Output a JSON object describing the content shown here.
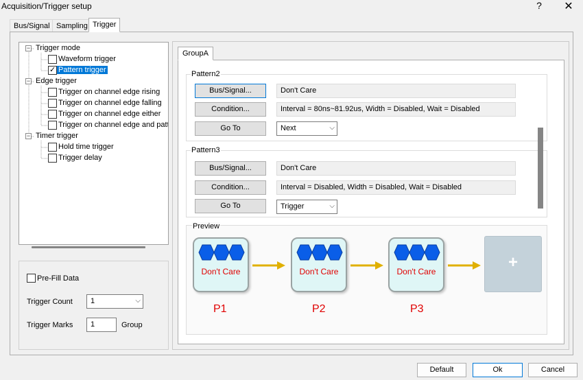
{
  "window": {
    "title": "Acquisition/Trigger setup",
    "help_glyph": "?",
    "close_glyph": "✕"
  },
  "tabs": [
    {
      "label": "Bus/Signal"
    },
    {
      "label": "Sampling"
    },
    {
      "label": "Trigger",
      "active": true
    }
  ],
  "tree": {
    "groups": [
      {
        "label": "Trigger mode",
        "items": [
          {
            "label": "Waveform trigger",
            "checked": false
          },
          {
            "label": "Pattern trigger",
            "checked": true,
            "selected": true
          }
        ]
      },
      {
        "label": "Edge trigger",
        "items": [
          {
            "label": "Trigger on channel edge rising",
            "checked": false
          },
          {
            "label": "Trigger on channel edge falling",
            "checked": false
          },
          {
            "label": "Trigger on channel edge either",
            "checked": false
          },
          {
            "label": "Trigger on channel edge and patt",
            "checked": false
          }
        ]
      },
      {
        "label": "Timer trigger",
        "items": [
          {
            "label": "Hold time trigger",
            "checked": false
          },
          {
            "label": "Trigger delay",
            "checked": false
          }
        ]
      }
    ]
  },
  "options": {
    "prefill_label": "Pre-Fill Data",
    "prefill_checked": false,
    "trigger_count_label": "Trigger Count",
    "trigger_count_value": "1",
    "trigger_marks_label": "Trigger Marks",
    "trigger_marks_value": "1",
    "trigger_marks_unit": "Group"
  },
  "group_tab": "GroupA",
  "patterns": [
    {
      "title": "Pattern2",
      "bus_signal_button": "Bus/Signal...",
      "bus_signal_value": "Don't Care",
      "condition_button": "Condition...",
      "condition_value": "Interval = 80ns~81.92us, Width = Disabled, Wait = Disabled",
      "goto_button": "Go To",
      "goto_value": "Next"
    },
    {
      "title": "Pattern3",
      "bus_signal_button": "Bus/Signal...",
      "bus_signal_value": "Don't Care",
      "condition_button": "Condition...",
      "condition_value": "Interval = Disabled, Width = Disabled, Wait = Disabled",
      "goto_button": "Go To",
      "goto_value": "Trigger"
    }
  ],
  "preview": {
    "title": "Preview",
    "blocks": [
      {
        "text": "Don't Care",
        "label": "P1"
      },
      {
        "text": "Don't Care",
        "label": "P2"
      },
      {
        "text": "Don't Care",
        "label": "P3"
      }
    ],
    "add_glyph": "+"
  },
  "footer": {
    "default": "Default",
    "ok": "Ok",
    "cancel": "Cancel"
  },
  "colors": {
    "accent": "#0078d7",
    "preview_label": "#e00000",
    "hexagon": "#0a5ee8",
    "arrow": "#e0b000",
    "block_bg": "#dff6f6"
  },
  "icons": {
    "expand": "minus-box-icon",
    "hexagon": "hexagon-icon",
    "arrow": "arrow-right-icon"
  }
}
